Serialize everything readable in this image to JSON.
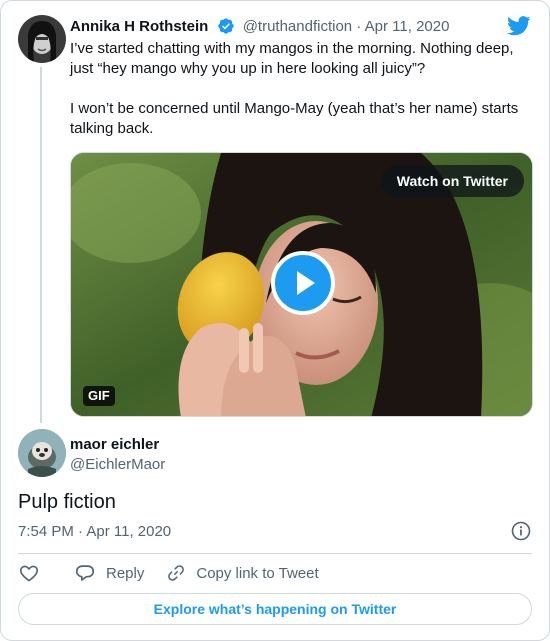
{
  "tweet": {
    "author_name": "Annika H Rothstein",
    "author_handle": "@truthandfiction",
    "separator": "·",
    "date": "Apr 11, 2020",
    "verified": true,
    "text_p1": "I’ve started chatting with my mangos in the morning. Nothing deep, just “hey mango why you up in here looking all juicy”?",
    "text_p2": "I won’t be concerned until Mango-May (yeah that’s her name) starts talking back.",
    "media": {
      "watch_label": "Watch on Twitter",
      "gif_badge": "GIF",
      "play_icon": "play-icon"
    }
  },
  "reply": {
    "author_name": "maor eichler",
    "author_handle": "@EichlerMaor",
    "text": "Pulp fiction",
    "timestamp": "7:54 PM · Apr 11, 2020"
  },
  "actions": {
    "like_icon": "heart-icon",
    "reply_label": "Reply",
    "copy_label": "Copy link to Tweet"
  },
  "explore_label": "Explore what’s happening on Twitter",
  "colors": {
    "accent": "#1d9bf0",
    "text": "#0f1419",
    "muted": "#536471",
    "border": "#cfd9de"
  }
}
